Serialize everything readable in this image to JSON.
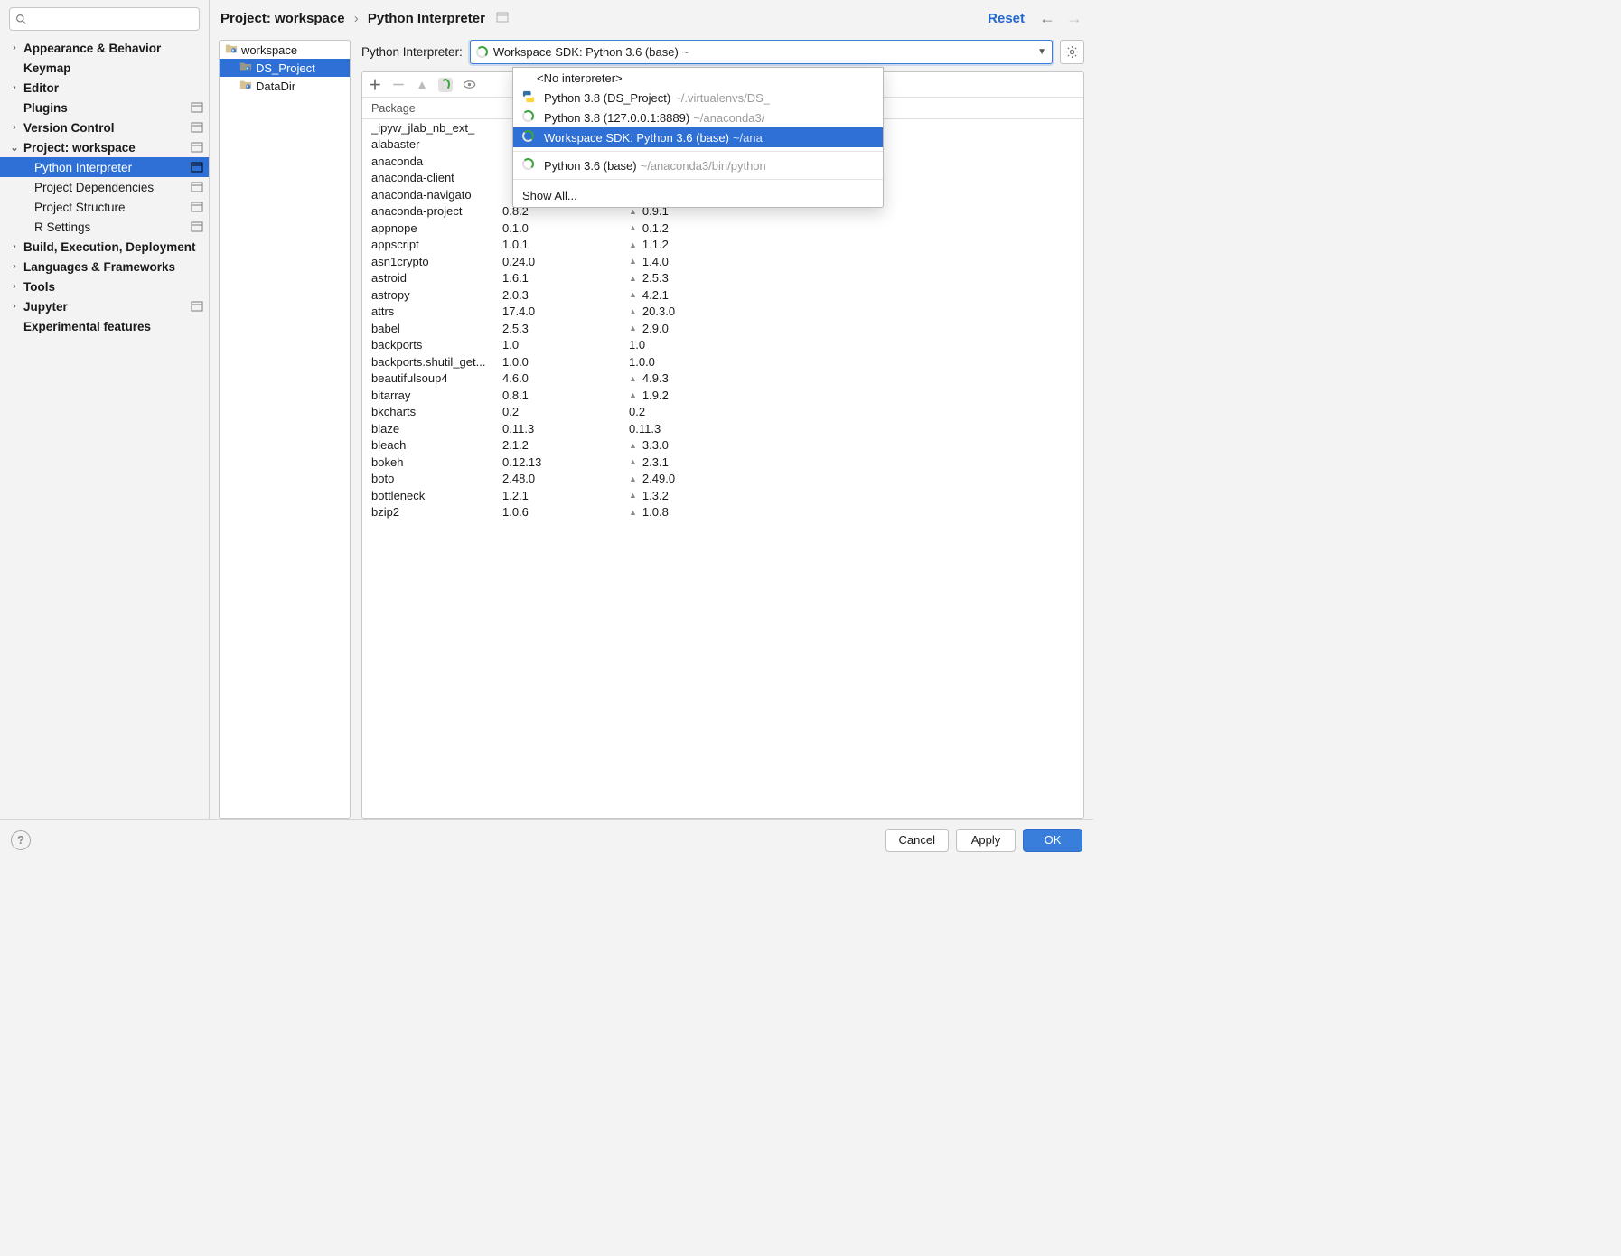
{
  "breadcrumb": {
    "part1": "Project: workspace",
    "sep": "›",
    "part2": "Python Interpreter"
  },
  "reset_label": "Reset",
  "sidebar": {
    "items": [
      {
        "label": "Appearance & Behavior",
        "bold": true,
        "chev": "right"
      },
      {
        "label": "Keymap",
        "bold": true
      },
      {
        "label": "Editor",
        "bold": true,
        "chev": "right"
      },
      {
        "label": "Plugins",
        "bold": true,
        "collapse": true
      },
      {
        "label": "Version Control",
        "bold": true,
        "chev": "right",
        "collapse": true
      },
      {
        "label": "Project: workspace",
        "bold": true,
        "chev": "down",
        "collapse": true
      },
      {
        "label": "Python Interpreter",
        "child": true,
        "selected": true,
        "collapse": true
      },
      {
        "label": "Project Dependencies",
        "child": true,
        "collapse": true
      },
      {
        "label": "Project Structure",
        "child": true,
        "collapse": true
      },
      {
        "label": "R Settings",
        "child": true,
        "collapse": true
      },
      {
        "label": "Build, Execution, Deployment",
        "bold": true,
        "chev": "right"
      },
      {
        "label": "Languages & Frameworks",
        "bold": true,
        "chev": "right"
      },
      {
        "label": "Tools",
        "bold": true,
        "chev": "right"
      },
      {
        "label": "Jupyter",
        "bold": true,
        "chev": "right",
        "collapse": true
      },
      {
        "label": "Experimental features",
        "bold": true
      }
    ]
  },
  "project_tree": [
    {
      "label": "workspace"
    },
    {
      "label": "DS_Project",
      "indent": true,
      "selected": true
    },
    {
      "label": "DataDir",
      "indent": true
    }
  ],
  "interpreter_label": "Python Interpreter:",
  "interpreter_selected": "Workspace SDK: Python 3.6 (base) ~",
  "interpreter_dropdown": {
    "no_interpreter": "<No interpreter>",
    "items": [
      {
        "icon": "python",
        "label": "Python 3.8 (DS_Project)",
        "path": "~/.virtualenvs/DS_"
      },
      {
        "icon": "spinner",
        "label": "Python 3.8 (127.0.0.1:8889)",
        "path": "~/anaconda3/"
      },
      {
        "icon": "spinner",
        "label": "Workspace SDK: Python 3.6 (base)",
        "path": "~/ana",
        "selected": true
      }
    ],
    "secondary": {
      "icon": "spinner",
      "label": "Python 3.6 (base)",
      "path": "~/anaconda3/bin/python"
    },
    "show_all": "Show All..."
  },
  "package_header": "Package",
  "packages": [
    {
      "name": "_ipyw_jlab_nb_ext_",
      "version": "",
      "latest": "",
      "upgradable": false
    },
    {
      "name": "alabaster",
      "version": "",
      "latest": "",
      "upgradable": false
    },
    {
      "name": "anaconda",
      "version": "",
      "latest": "",
      "upgradable": false
    },
    {
      "name": "anaconda-client",
      "version": "",
      "latest": "",
      "upgradable": false
    },
    {
      "name": "anaconda-navigato",
      "version": "",
      "latest": "",
      "upgradable": false
    },
    {
      "name": "anaconda-project",
      "version": "0.8.2",
      "latest": "0.9.1",
      "upgradable": true
    },
    {
      "name": "appnope",
      "version": "0.1.0",
      "latest": "0.1.2",
      "upgradable": true
    },
    {
      "name": "appscript",
      "version": "1.0.1",
      "latest": "1.1.2",
      "upgradable": true
    },
    {
      "name": "asn1crypto",
      "version": "0.24.0",
      "latest": "1.4.0",
      "upgradable": true
    },
    {
      "name": "astroid",
      "version": "1.6.1",
      "latest": "2.5.3",
      "upgradable": true
    },
    {
      "name": "astropy",
      "version": "2.0.3",
      "latest": "4.2.1",
      "upgradable": true
    },
    {
      "name": "attrs",
      "version": "17.4.0",
      "latest": "20.3.0",
      "upgradable": true
    },
    {
      "name": "babel",
      "version": "2.5.3",
      "latest": "2.9.0",
      "upgradable": true
    },
    {
      "name": "backports",
      "version": "1.0",
      "latest": "1.0",
      "upgradable": false
    },
    {
      "name": "backports.shutil_get...",
      "version": "1.0.0",
      "latest": "1.0.0",
      "upgradable": false
    },
    {
      "name": "beautifulsoup4",
      "version": "4.6.0",
      "latest": "4.9.3",
      "upgradable": true
    },
    {
      "name": "bitarray",
      "version": "0.8.1",
      "latest": "1.9.2",
      "upgradable": true
    },
    {
      "name": "bkcharts",
      "version": "0.2",
      "latest": "0.2",
      "upgradable": false
    },
    {
      "name": "blaze",
      "version": "0.11.3",
      "latest": "0.11.3",
      "upgradable": false
    },
    {
      "name": "bleach",
      "version": "2.1.2",
      "latest": "3.3.0",
      "upgradable": true
    },
    {
      "name": "bokeh",
      "version": "0.12.13",
      "latest": "2.3.1",
      "upgradable": true
    },
    {
      "name": "boto",
      "version": "2.48.0",
      "latest": "2.49.0",
      "upgradable": true
    },
    {
      "name": "bottleneck",
      "version": "1.2.1",
      "latest": "1.3.2",
      "upgradable": true
    },
    {
      "name": "bzip2",
      "version": "1.0.6",
      "latest": "1.0.8",
      "upgradable": true
    }
  ],
  "footer": {
    "cancel": "Cancel",
    "apply": "Apply",
    "ok": "OK"
  }
}
